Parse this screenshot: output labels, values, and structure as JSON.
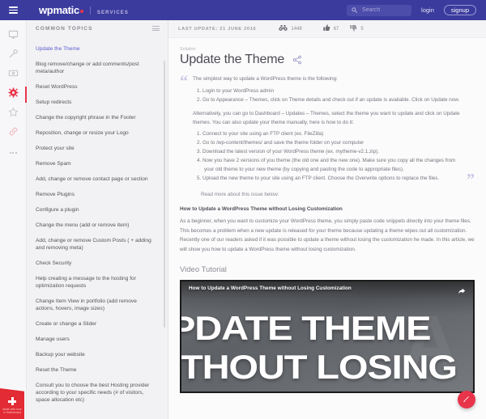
{
  "topbar": {
    "menu_icon": "hamburger-icon",
    "brand_name": "wpmatic",
    "brand_sub": "SERVICES",
    "search": {
      "placeholder": "Search",
      "value": "",
      "icon": "search-icon"
    },
    "login_label": "login",
    "signup_label": "signup",
    "accent": "#e8344a",
    "bar_color": "#3b3b9e"
  },
  "rail": {
    "items": [
      {
        "icon": "monitor-icon",
        "active": false
      },
      {
        "icon": "magic-wand-icon",
        "active": false
      },
      {
        "icon": "wallet-icon",
        "active": false
      },
      {
        "icon": "gear-icon",
        "active": true
      },
      {
        "icon": "star-icon",
        "active": false
      },
      {
        "icon": "link-icon",
        "active": false
      },
      {
        "icon": "ellipsis-icon",
        "active": false
      }
    ],
    "badge": {
      "line1": "Made with love",
      "line2": "in Switzerland",
      "color": "#e22b34"
    }
  },
  "sidebar": {
    "title": "COMMON TOPICS",
    "filter_icon": "filter-icon",
    "items": [
      {
        "label": "Update the Theme",
        "active": true
      },
      {
        "label": "Blog remove/change or add comments/post meta/author",
        "active": false
      },
      {
        "label": "Reset WordPress",
        "active": false
      },
      {
        "label": "Setup redirects",
        "active": false
      },
      {
        "label": "Change the copyright phrase in the Footer",
        "active": false
      },
      {
        "label": "Reposition, change or resize your Logo",
        "active": false
      },
      {
        "label": "Protect your site",
        "active": false
      },
      {
        "label": "Remove Spam",
        "active": false
      },
      {
        "label": "Add, change or remove contact page or section",
        "active": false
      },
      {
        "label": "Remove Plugins",
        "active": false
      },
      {
        "label": "Configure a plugin",
        "active": false
      },
      {
        "label": "Change the menu (add or remove item)",
        "active": false
      },
      {
        "label": "Add, change or remove Custom Posts ( + adding and removing meta)",
        "active": false
      },
      {
        "label": "Check Security",
        "active": false
      },
      {
        "label": "Help creating a message to the hosting for optimization requests",
        "active": false
      },
      {
        "label": "Change Item View in portfolio (add remove actions, hovers, image sizes)",
        "active": false
      },
      {
        "label": "Create or change a Slider",
        "active": false
      },
      {
        "label": "Manage users",
        "active": false
      },
      {
        "label": "Backup your website",
        "active": false
      },
      {
        "label": "Reset the Theme",
        "active": false
      },
      {
        "label": "Consult you to choose the best Hosting provider according to your specific needs (# of visitors, space allocation etc)",
        "active": false
      }
    ]
  },
  "main": {
    "meta": {
      "last_update": "LAST UPDATE: 21 JUNE 2016",
      "views_icon": "binoculars-icon",
      "views": "1448",
      "thumbs_up_icon": "thumbs-up-icon",
      "thumbs_up": "67",
      "thumbs_down_icon": "thumbs-down-icon",
      "thumbs_down": "5"
    },
    "kicker": "Solution",
    "title": "Update the Theme",
    "share_icon": "share-icon",
    "quote": {
      "open_mark": "“",
      "close_mark": "”",
      "lead": "The simplest way to update a WordPress theme is the following:",
      "steps_a": [
        "1. Login to your WordPress admin",
        "2. Go to Appearance – Themes, click on Theme details and check out if an update is available. Click on Update now."
      ],
      "alt_para": "Alternatively, you can go to Dashboard – Updates – Themes, select the theme you want to update and click on Update themes. You can also update your theme manually, here is how to do it:",
      "steps_b": [
        "1. Connect to your site using an FTP client (ex. FileZilla)",
        "2. Go to /wp-content/themes/ and save the theme folder on your computer",
        "3. Download the latest version of your WordPress theme (ex. mytheme-v2.1.zip).",
        "4. Now you have 2 versions of you theme (the old one and the new one). Make sure you copy all the changes from your old theme to your new theme (by copying and pasting the code to appropriate files).",
        "5. Upload the new theme to your site using an FTP client. Choose the Overwrite options to replace the files."
      ],
      "read_more": "Read more about this issue below:"
    },
    "article": {
      "subheading": "How to Update a WordPress Theme without Losing Customization",
      "body": "As a beginner, when you want to customize your WordPress theme, you simply paste code snippets directly into your theme files. This becomes a problem when a new update is released for your theme because updating a theme wipes out all customization. Recently one of our readers asked if it was possible to update a theme without losing the customization he made. In this article, we will show you how to update a WordPress theme without losing customization."
    },
    "video_section_title": "Video Tutorial",
    "video": {
      "title": "How to Update a WordPress Theme without Losing Customization",
      "share_icon": "video-share-icon",
      "line1": "PDATE THEME",
      "line2": "ITHOUT LOSING",
      "ghost": "A"
    },
    "fab_icon": "edit-pencil-icon"
  }
}
